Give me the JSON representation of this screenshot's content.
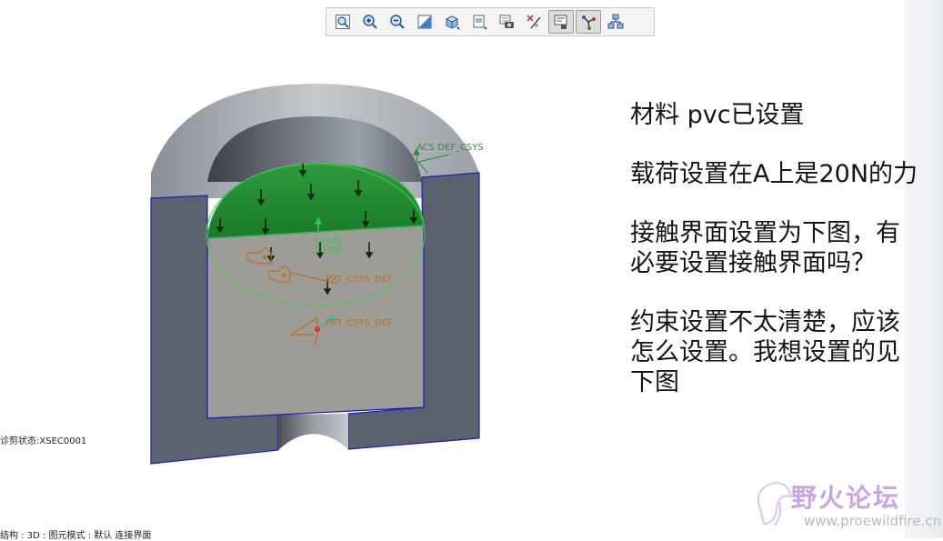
{
  "toolbar": {
    "buttons": [
      {
        "icon": "zoom-fit-icon",
        "active": false
      },
      {
        "icon": "zoom-in-icon",
        "active": false
      },
      {
        "icon": "zoom-out-icon",
        "active": false
      },
      {
        "icon": "repaint-icon",
        "active": false
      },
      {
        "icon": "display-style-icon",
        "active": false
      },
      {
        "icon": "saved-views-icon",
        "active": false
      },
      {
        "icon": "view-manager-icon",
        "active": false
      },
      {
        "icon": "datum-display-icon",
        "active": false
      },
      {
        "icon": "annotation-display-icon",
        "active": true
      },
      {
        "icon": "spin-center-icon",
        "active": true
      },
      {
        "icon": "model-tree-icon",
        "active": false
      }
    ]
  },
  "model_labels": {
    "csys_top": "ACS DEF_CSYS",
    "load_name": "Load1",
    "load_value": "20 (N)",
    "prt_csys_1": "PRT_CSYS_DEF",
    "prt_csys_2": "PRT_CSYS_DEF"
  },
  "status": {
    "section_state": "诊剪状态:XSEC0001",
    "bottom_info": "结构 : 3D : 图元模式 : 默认 连接界面"
  },
  "notes": [
    {
      "lines": [
        "材料 pvc已设置"
      ]
    },
    {
      "lines": [
        "载荷设置在A上是20N的力"
      ]
    },
    {
      "lines": [
        "接触界面设置为下图，有",
        "必要设置接触界面吗？"
      ]
    },
    {
      "lines": [
        "约束设置不太清楚，应该",
        "怎么设置。我想设置的见",
        "下图"
      ]
    }
  ],
  "watermark": {
    "title": "野火论坛",
    "url": "www.proewildfire.cn"
  },
  "colors": {
    "load_green": "#1e8a2e",
    "load_label": "#2ecc40",
    "csys_orange": "#c07020",
    "edge_blue": "#1a1acc",
    "solid_gray": "#5e6470",
    "section_face": "#9d9c96"
  }
}
